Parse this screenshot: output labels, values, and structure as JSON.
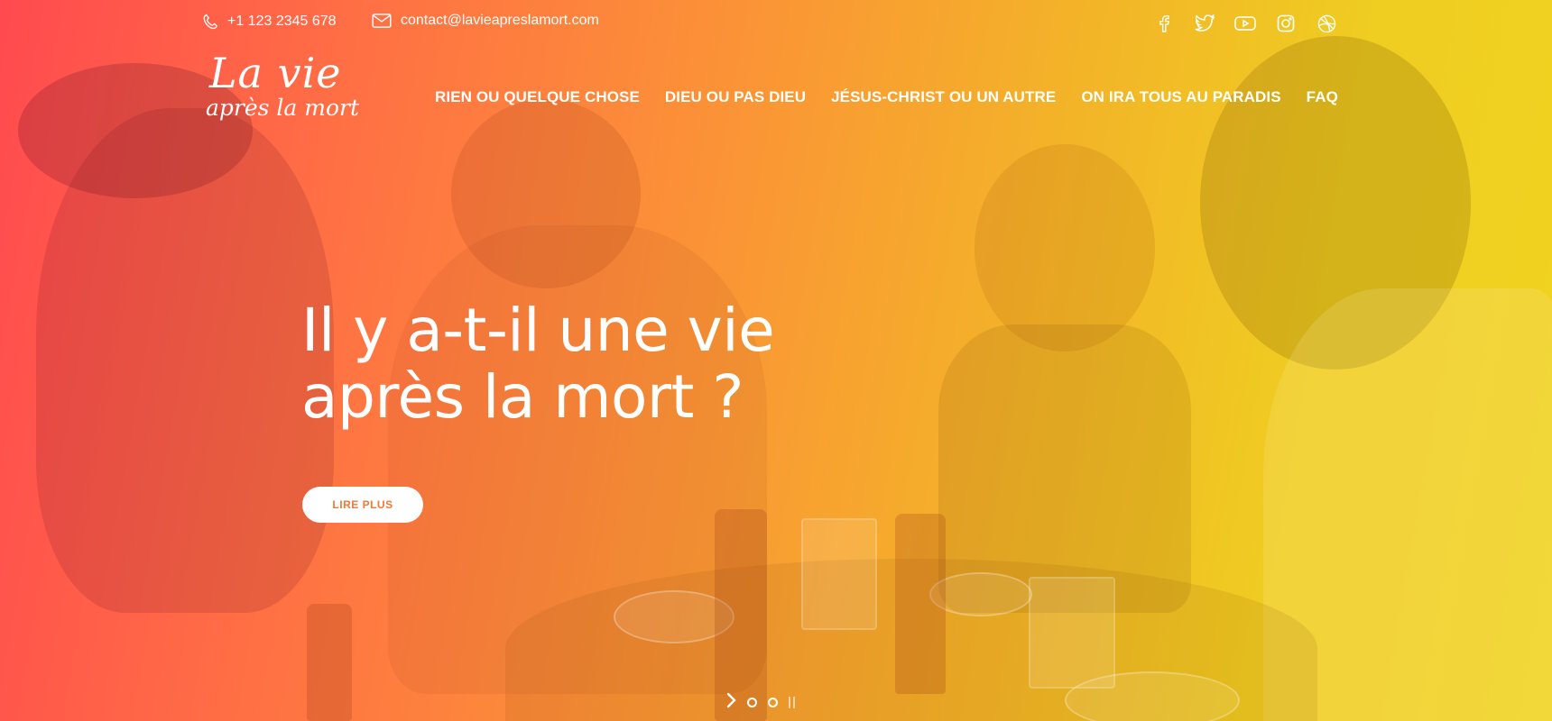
{
  "topbar": {
    "phone": "+1 123 2345 678",
    "email": "contact@lavieapreslamort.com",
    "social": [
      "facebook-icon",
      "twitter-icon",
      "youtube-icon",
      "instagram-icon",
      "dribbble-icon"
    ]
  },
  "logo": {
    "line1": "La vie",
    "line2": "après la mort"
  },
  "nav": {
    "items": [
      {
        "label": "RIEN OU QUELQUE CHOSE"
      },
      {
        "label": "DIEU OU PAS DIEU"
      },
      {
        "label": "JÉSUS-CHRIST OU UN AUTRE"
      },
      {
        "label": "ON IRA TOUS AU PARADIS"
      },
      {
        "label": "FAQ"
      }
    ]
  },
  "hero": {
    "headline_line1": "Il y a-t-il une vie",
    "headline_line2": "après la mort ?",
    "cta_label": "LIRE PLUS"
  },
  "slider": {
    "slide_count": 2,
    "controls": [
      "chevron-right-icon",
      "dot",
      "dot",
      "pause-icon"
    ]
  },
  "colors": {
    "gradient_start": "#ff4a4f",
    "gradient_mid": "#fb9436",
    "gradient_end": "#f0d320",
    "cta_text": "#f27836",
    "text": "#ffffff"
  }
}
